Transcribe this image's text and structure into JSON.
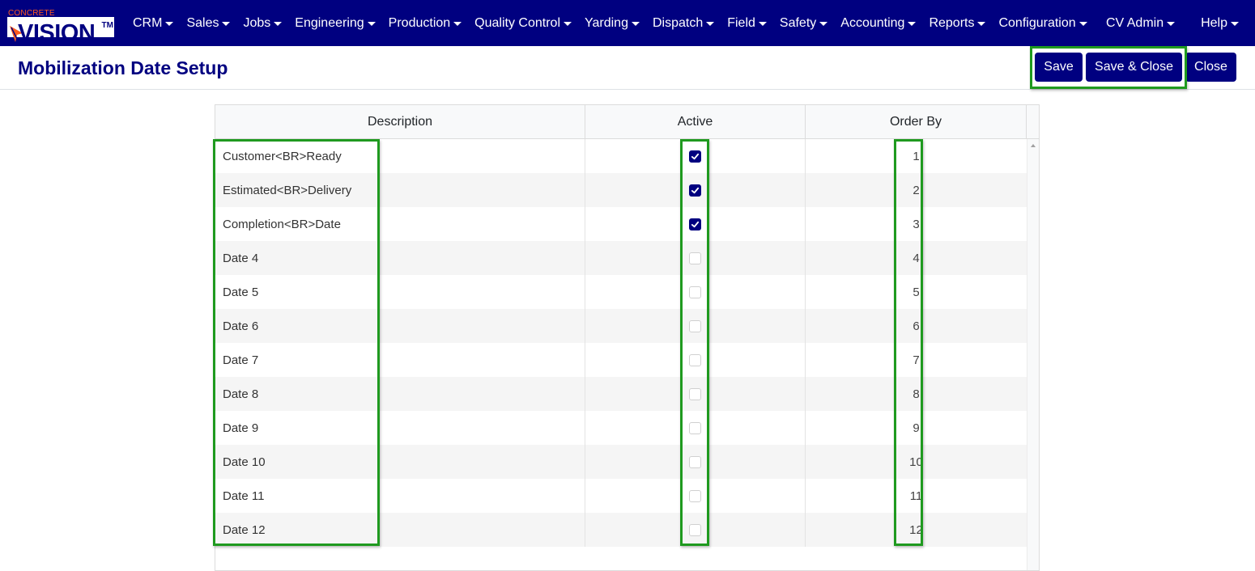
{
  "brand": {
    "top_text": "CONCRETE",
    "name": "VISION",
    "tm": "TM",
    "orange": "#ff5a1f",
    "navy": "#000080"
  },
  "nav": {
    "items": [
      {
        "label": "CRM"
      },
      {
        "label": "Sales"
      },
      {
        "label": "Jobs"
      },
      {
        "label": "Engineering"
      },
      {
        "label": "Production"
      },
      {
        "label": "Quality Control"
      },
      {
        "label": "Yarding"
      },
      {
        "label": "Dispatch"
      },
      {
        "label": "Field"
      },
      {
        "label": "Safety"
      },
      {
        "label": "Accounting"
      },
      {
        "label": "Reports"
      },
      {
        "label": "Configuration"
      }
    ],
    "right": [
      {
        "label": "CV Admin"
      },
      {
        "label": "Help"
      }
    ]
  },
  "page": {
    "title": "Mobilization Date Setup"
  },
  "toolbar": {
    "save_label": "Save",
    "save_close_label": "Save & Close",
    "close_label": "Close"
  },
  "table": {
    "columns": [
      "Description",
      "Active",
      "Order By"
    ],
    "rows": [
      {
        "description": "Customer<BR>Ready",
        "active": true,
        "order": "1"
      },
      {
        "description": "Estimated<BR>Delivery",
        "active": true,
        "order": "2"
      },
      {
        "description": "Completion<BR>Date",
        "active": true,
        "order": "3"
      },
      {
        "description": "Date 4",
        "active": false,
        "order": "4"
      },
      {
        "description": "Date 5",
        "active": false,
        "order": "5"
      },
      {
        "description": "Date 6",
        "active": false,
        "order": "6"
      },
      {
        "description": "Date 7",
        "active": false,
        "order": "7"
      },
      {
        "description": "Date 8",
        "active": false,
        "order": "8"
      },
      {
        "description": "Date 9",
        "active": false,
        "order": "9"
      },
      {
        "description": "Date 10",
        "active": false,
        "order": "10"
      },
      {
        "description": "Date 11",
        "active": false,
        "order": "11"
      },
      {
        "description": "Date 12",
        "active": false,
        "order": "12"
      }
    ]
  },
  "colors": {
    "accent": "#000080",
    "highlight": "#1f9a1f",
    "row_alt": "#f5f5f5"
  }
}
